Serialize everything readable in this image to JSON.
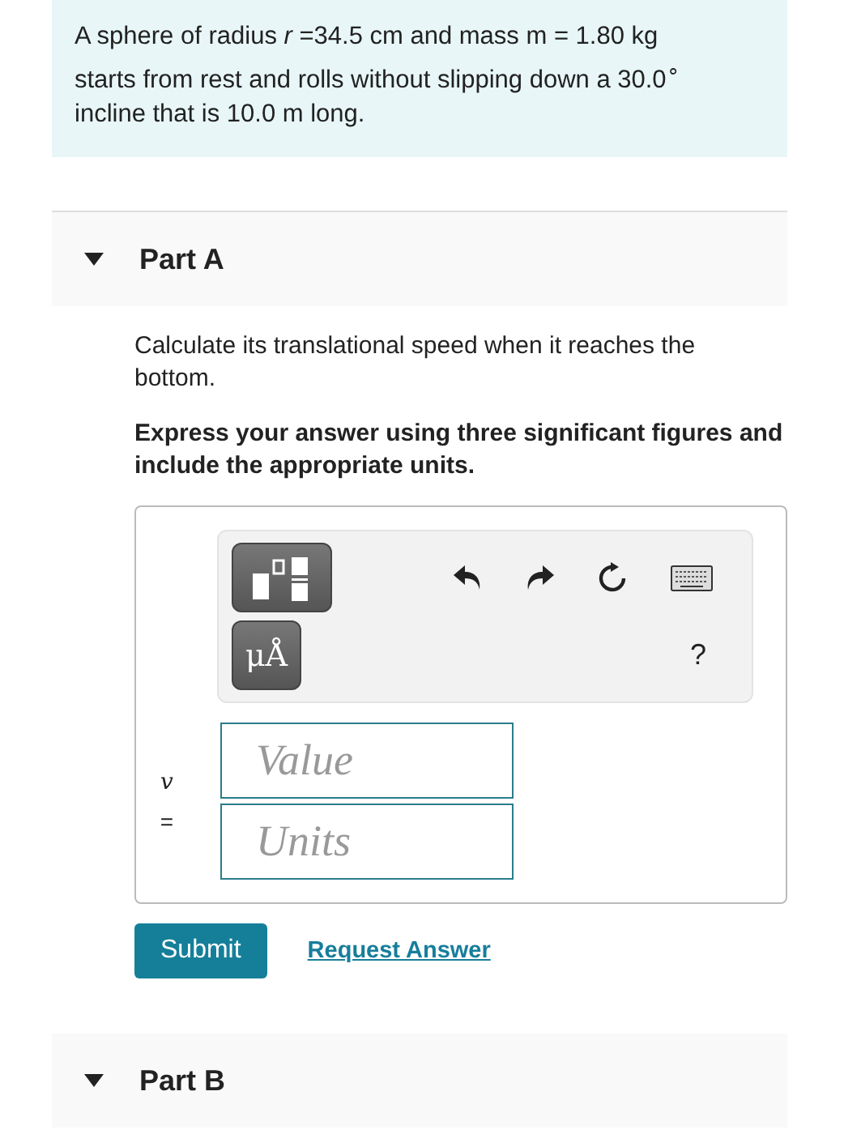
{
  "problem": {
    "text": "A sphere of radius *r* =34.5 cm and mass m = 1.80 kg starts from rest and rolls without slipping down a 30.0$^{∘}$ incline that is 10.0 m long."
  },
  "parts": [
    {
      "title": "Part A",
      "expanded": true,
      "question": "Calculate its translational speed when it reaches the bottom.",
      "instruction": "Express your answer using three significant figures and include the appropriate units.",
      "toolbar": {
        "units_button": "μÅ",
        "help": "?"
      },
      "variable": "v",
      "equals": "=",
      "value_field": {
        "placeholder": "Value"
      },
      "units_field": {
        "placeholder": "Units"
      },
      "submit": "Submit",
      "request": "Request Answer"
    },
    {
      "title": "Part B",
      "expanded": true
    }
  ]
}
